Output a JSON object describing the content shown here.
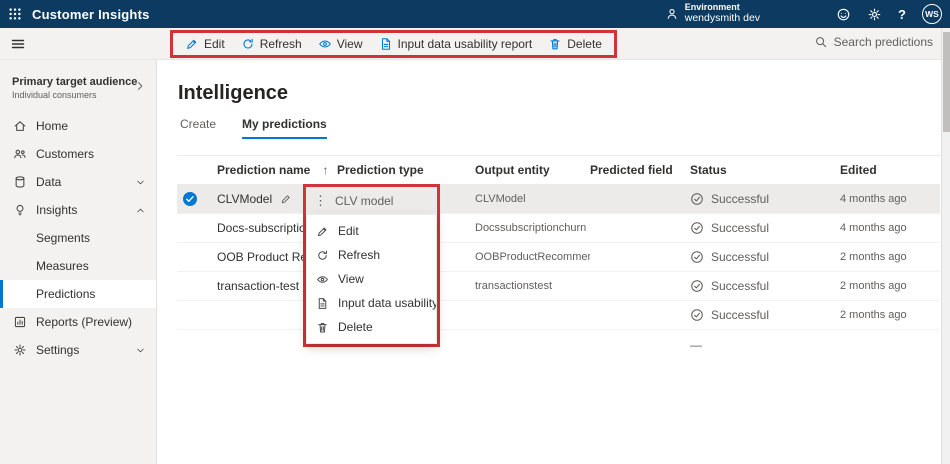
{
  "colors": {
    "topbar_bg": "#0d3a60",
    "accent_blue": "#0078d4",
    "highlight_red": "#d13438",
    "sidebar_bg": "#f3f2f1",
    "selected_row_bg": "#edebe9",
    "text_primary": "#323130",
    "text_secondary": "#605e5c"
  },
  "topbar": {
    "app_title": "Customer Insights",
    "environment_label": "Environment",
    "environment_value": "wendysmith dev",
    "help_icon": "?",
    "avatar_initials": "WS"
  },
  "command_bar": {
    "buttons": [
      {
        "label": "Edit"
      },
      {
        "label": "Refresh"
      },
      {
        "label": "View"
      },
      {
        "label": "Input data usability report"
      },
      {
        "label": "Delete"
      }
    ],
    "search_label": "Search predictions"
  },
  "sidebar": {
    "audience_title": "Primary target audience",
    "audience_subtitle": "Individual consumers",
    "items": [
      {
        "label": "Home"
      },
      {
        "label": "Customers"
      },
      {
        "label": "Data"
      },
      {
        "label": "Insights"
      },
      {
        "label": "Segments"
      },
      {
        "label": "Measures"
      },
      {
        "label": "Predictions"
      },
      {
        "label": "Reports (Preview)"
      },
      {
        "label": "Settings"
      }
    ]
  },
  "main": {
    "title": "Intelligence",
    "tabs": [
      {
        "label": "Create"
      },
      {
        "label": "My predictions"
      }
    ],
    "table": {
      "sort_icon": "↑",
      "columns": [
        "Prediction name",
        "Prediction type",
        "Output entity",
        "Predicted field",
        "Status",
        "Edited"
      ],
      "rows": [
        {
          "name": "CLVModel",
          "type": "CLV model",
          "output": "CLVModel",
          "predicted": "",
          "status": "Successful",
          "edited": "4 months ago"
        },
        {
          "name": "Docs-subscription",
          "type": "",
          "output": "Docssubscriptionchurn",
          "predicted": "",
          "status": "Successful",
          "edited": "4 months ago"
        },
        {
          "name": "OOB Product Reco",
          "type": "",
          "output": "OOBProductRecommendation",
          "predicted": "",
          "status": "Successful",
          "edited": "2 months ago"
        },
        {
          "name": "transaction-test",
          "type": "",
          "output": "transactionstest",
          "predicted": "",
          "status": "Successful",
          "edited": "2 months ago"
        },
        {
          "name": "",
          "type": "",
          "output": "",
          "predicted": "",
          "status": "Successful",
          "edited": "2 months ago"
        },
        {
          "name": "",
          "type": "",
          "output": "",
          "predicted": "",
          "status": "—",
          "edited": ""
        }
      ]
    },
    "context_menu": {
      "more_icon": "⋮",
      "header": "CLV model",
      "items": [
        {
          "label": "Edit"
        },
        {
          "label": "Refresh"
        },
        {
          "label": "View"
        },
        {
          "label": "Input data usability report"
        },
        {
          "label": "Delete"
        }
      ]
    }
  }
}
